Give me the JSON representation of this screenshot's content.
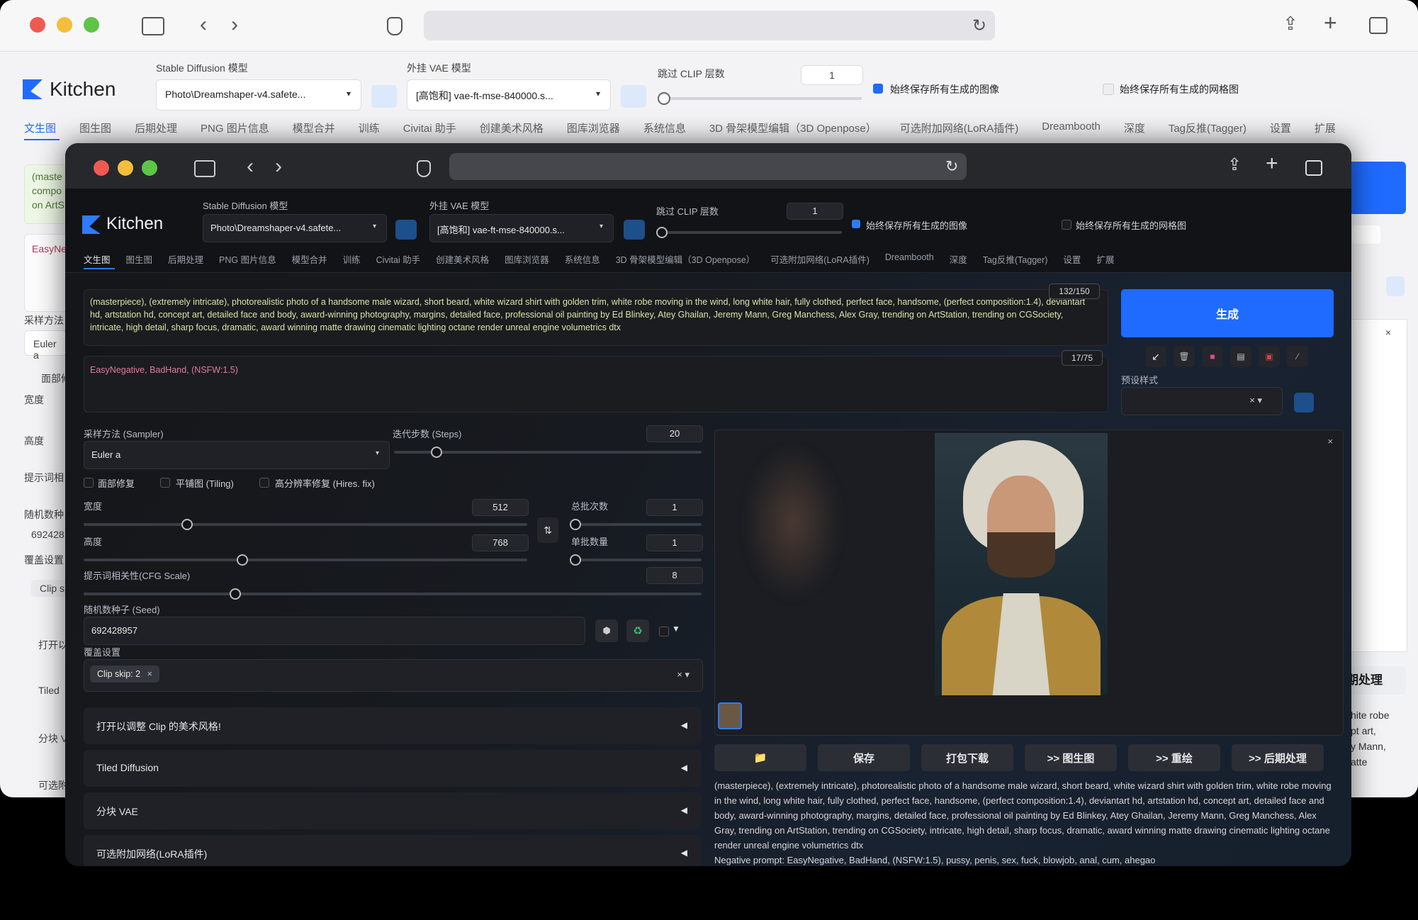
{
  "bg": {
    "brand": "Kitchen",
    "sd_model_label": "Stable Diffusion 模型",
    "sd_model_value": "Photo\\Dreamshaper-v4.safete...",
    "vae_label": "外挂 VAE 模型",
    "vae_value": "[高饱和] vae-ft-mse-840000.s...",
    "clip_label": "跳过 CLIP 层数",
    "clip_value": "1",
    "save_all_images": "始终保存所有生成的图像",
    "save_all_grids": "始终保存所有生成的网格图",
    "tabs": [
      "文生图",
      "图生图",
      "后期处理",
      "PNG 图片信息",
      "模型合并",
      "训练",
      "Civitai 助手",
      "创建美术风格",
      "图库浏览器",
      "系统信息",
      "3D 骨架模型编辑（3D Openpose）",
      "可选附加网络(LoRA插件)",
      "Dreambooth",
      "深度",
      "Tag反推(Tagger)",
      "设置",
      "扩展"
    ],
    "left_fragments": [
      "(maste",
      "compo",
      "on ArtS",
      "EasyNe",
      "采样方法",
      "Euler a",
      "面部修",
      "宽度",
      "高度",
      "提示词相",
      "随机数种",
      "692428",
      "覆盖设置",
      "Clip s",
      "打开以",
      "Tiled",
      "分块 V",
      "可选附"
    ],
    "right_fragments": [
      "期处理",
      "hite robe",
      "pt art,",
      "y Mann,",
      "atte"
    ]
  },
  "app": {
    "brand": "Kitchen",
    "sd_model_label": "Stable Diffusion 模型",
    "sd_model_value": "Photo\\Dreamshaper-v4.safete...",
    "vae_label": "外挂 VAE 模型",
    "vae_value": "[高饱和] vae-ft-mse-840000.s...",
    "clip_label": "跳过 CLIP 层数",
    "clip_value": "1",
    "save_all_images": "始终保存所有生成的图像",
    "save_all_grids": "始终保存所有生成的网格图",
    "tabs": [
      "文生图",
      "图生图",
      "后期处理",
      "PNG 图片信息",
      "模型合并",
      "训练",
      "Civitai 助手",
      "创建美术风格",
      "图库浏览器",
      "系统信息",
      "3D 骨架模型编辑（3D Openpose）",
      "可选附加网络(LoRA插件)",
      "Dreambooth",
      "深度",
      "Tag反推(Tagger)",
      "设置",
      "扩展"
    ],
    "prompt": "(masterpiece), (extremely intricate), photorealistic photo of a handsome male wizard, short beard, white wizard shirt with golden trim, white robe moving in the wind, long white hair, fully clothed, perfect face, handsome, (perfect composition:1.4), deviantart hd, artstation hd, concept art, detailed face and body, award-winning photography, margins, detailed face, professional oil painting by Ed Blinkey, Atey Ghailan, Jeremy Mann, Greg Manchess, Alex Gray, trending on ArtStation, trending on CGSociety, intricate, high detail, sharp focus, dramatic, award winning matte drawing cinematic lighting octane render unreal engine volumetrics dtx",
    "prompt_count": "132/150",
    "negative": "EasyNegative, BadHand, (NSFW:1.5)",
    "negative_count": "17/75",
    "generate": "生成",
    "styles_label": "预设样式",
    "sampler_label": "采样方法 (Sampler)",
    "sampler_value": "Euler a",
    "steps_label": "迭代步数 (Steps)",
    "steps_value": "20",
    "face_restore": "面部修复",
    "tiling": "平铺图 (Tiling)",
    "hires": "高分辨率修复 (Hires. fix)",
    "width_label": "宽度",
    "width_value": "512",
    "height_label": "高度",
    "height_value": "768",
    "batch_count_label": "总批次数",
    "batch_count_value": "1",
    "batch_size_label": "单批数量",
    "batch_size_value": "1",
    "cfg_label": "提示词相关性(CFG Scale)",
    "cfg_value": "8",
    "seed_label": "随机数种子 (Seed)",
    "seed_value": "692428957",
    "override_label": "覆盖设置",
    "override_chip": "Clip skip: 2",
    "accordions": [
      "打开以调整 Clip 的美术风格!",
      "Tiled Diffusion",
      "分块 VAE",
      "可选附加网络(LoRA插件)"
    ],
    "out_buttons": [
      "保存",
      "打包下载",
      ">> 图生图",
      ">> 重绘",
      ">> 后期处理"
    ],
    "output_info": "(masterpiece), (extremely intricate), photorealistic photo of a handsome male wizard, short beard, white wizard shirt with golden trim, white robe moving in the wind, long white hair, fully clothed, perfect face, handsome, (perfect composition:1.4), deviantart hd, artstation hd, concept art, detailed face and body, award-winning photography, margins, detailed face, professional oil painting by Ed Blinkey, Atey Ghailan, Jeremy Mann, Greg Manchess, Alex Gray, trending on ArtStation, trending on CGSociety, intricate, high detail, sharp focus, dramatic, award winning matte drawing cinematic lighting octane render unreal engine volumetrics dtx",
    "output_info_2": "Negative prompt: EasyNegative, BadHand, (NSFW:1.5), pussy, penis, sex, fuck, blowjob, anal, cum, ahegao",
    "accent": "#1f6bff"
  }
}
